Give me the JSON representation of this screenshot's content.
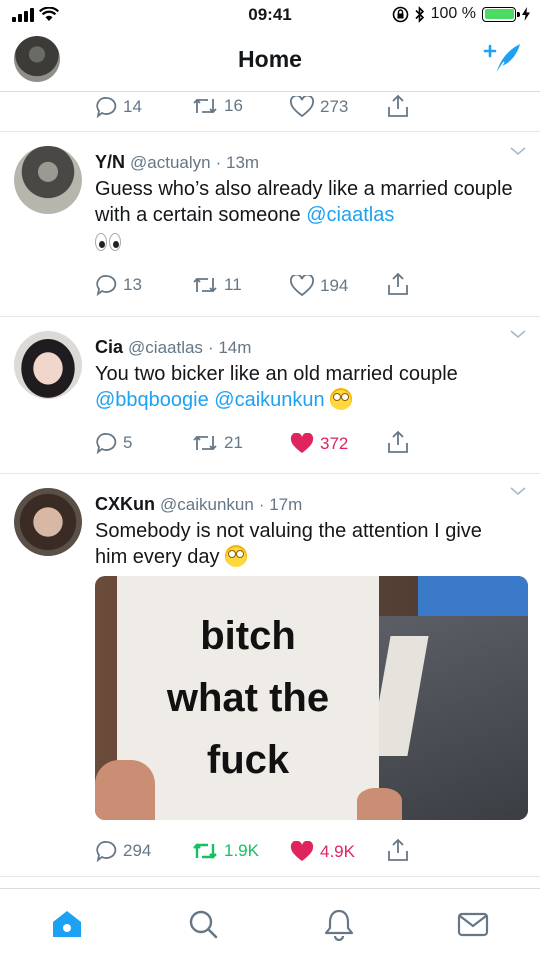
{
  "status_bar": {
    "time": "09:41",
    "battery": "100 %"
  },
  "header": {
    "title": "Home",
    "compose_icon": "compose-tweet-icon"
  },
  "partial_tweet": {
    "replies": "14",
    "retweets": "16",
    "likes": "273"
  },
  "tweets": [
    {
      "name": "Y/N",
      "handle": "@actualyn",
      "time": "· 13m",
      "text_parts": [
        "Guess who’s also already like a married couple with a certain someone ",
        "@ciaatlas"
      ],
      "emoji": "👀",
      "replies": "13",
      "retweets": "11",
      "likes": "194",
      "liked": false
    },
    {
      "name": "Cia",
      "handle": "@ciaatlas",
      "time": "· 14m",
      "text": "You two bicker like an old married couple",
      "mentions": "@bbqboogie @caikunkun",
      "emoji": "🙄",
      "replies": "5",
      "retweets": "21",
      "likes": "372",
      "liked": true
    },
    {
      "name": "CXKun",
      "handle": "@caikunkun",
      "time": "· 17m",
      "text": "Somebody is not valuing the attention I give him every day",
      "emoji": "🙄",
      "image_text": [
        "bitch",
        "what the",
        "fuck"
      ],
      "replies": "294",
      "retweets": "1.9K",
      "likes": "4.9K",
      "liked": true,
      "retweeted": true
    }
  ],
  "tabbar": [
    "home-icon",
    "search-icon",
    "notifications-icon",
    "messages-icon"
  ],
  "colors": {
    "accent": "#1da1f2",
    "like": "#e0245e",
    "retweet": "#17bf63",
    "muted": "#657786"
  }
}
